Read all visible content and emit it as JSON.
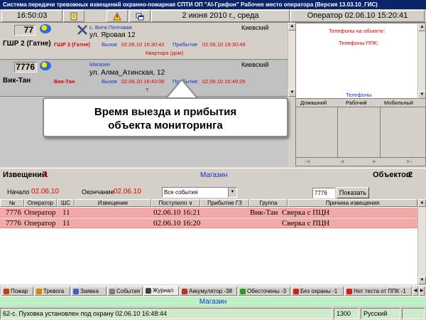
{
  "window": {
    "title": "Система передачи тревожных извещений охранно-пожарная СПТИ ОП \"AI-Грифон\" Рабочее место оператора (Версия 13.03.10_ГИС)"
  },
  "topbar": {
    "time": "16:50:03",
    "date": "2 июня 2010 г., среда",
    "operator": "Оператор  02.06.10 15:20:41"
  },
  "cards": [
    {
      "number": "77",
      "name": "ГШР 2 (Гатне)",
      "group": "ГШР 2 (Гатне)",
      "title": "с. Вита Почтовая",
      "address": "ул. Яровая 12",
      "district": "Киевский",
      "depart_label": "Вызов",
      "depart_time": "02.06.10 16:30:42",
      "arrive_label": "Прибытие",
      "arrive_time": "02.06.10 16:30:49",
      "extra": "Квартира (дом)"
    },
    {
      "number": "7776",
      "name": "Вик-Тан",
      "group": "Вик-Тан",
      "title": "Магазин",
      "address": "ул. Алма_Атинская, 12",
      "district": "Киевский",
      "depart_label": "Вызов",
      "depart_time": "02.06.10 16:43:06",
      "arrive_label": "Прибытие",
      "arrive_time": "02.06.10 16:49:29",
      "extra": "Т"
    }
  ],
  "right_panel": {
    "phones_object": "Телефоны на объекте:",
    "phones_ppk": "Телефоны ППК:",
    "phones_header": "Телефоны",
    "col_home": "Домашний",
    "col_work": "Рабочий",
    "col_mobile": "Мобильный"
  },
  "callout": {
    "line1": "Время выезда и прибытия",
    "line2": "объекта мониторинга"
  },
  "status_strip": {
    "notices_label": "Извещений",
    "notices_count": "1",
    "object_name": "Магазин",
    "objects_label": "Объектов",
    "objects_count": "2"
  },
  "filter": {
    "start_label": "Начало",
    "start_value": "02.06.10",
    "end_label": "Окончание",
    "end_value": "02.06.10",
    "events_select": "Все события",
    "object_input": "7776",
    "show_button": "Показать"
  },
  "table": {
    "headers": [
      "№",
      "Оператор",
      "ШС",
      "Извещение",
      "Поступило ∨",
      "Прибытие ГЗ",
      "Группа",
      "Причина извещения"
    ],
    "rows": [
      {
        "num": "7776",
        "operator": "Оператор",
        "zone": "11",
        "notice": "",
        "received": "02.06.10 16:21",
        "arrival": "",
        "group": "Вик-Тан",
        "reason": "Сверка с ПЦН"
      },
      {
        "num": "7776",
        "operator": "Оператор",
        "zone": "11",
        "notice": "",
        "received": "02.06.10 16:20",
        "arrival": "",
        "group": "",
        "reason": "Сверка с ПЦН"
      }
    ]
  },
  "tabs": [
    {
      "label": "Пожар",
      "color": "#c04010"
    },
    {
      "label": "Тревога",
      "color": "#e08000"
    },
    {
      "label": "Заявка",
      "color": "#4060c0"
    },
    {
      "label": "События",
      "color": "#808080"
    },
    {
      "label": "Журнал",
      "color": "#404040"
    },
    {
      "label": "Аккумулятор -38",
      "color": "#c03030"
    },
    {
      "label": "Обесточены -3",
      "color": "#20a020"
    },
    {
      "label": "Без охраны -1",
      "color": "#d02020"
    },
    {
      "label": "Нет теста от ППК -1",
      "color": "#d02020"
    }
  ],
  "banner": {
    "text": "Магазин"
  },
  "statusbar": {
    "message": "62-с. Пуховка установлен под охрану 02.06.10 16:48:44",
    "code": "1300",
    "lang": "Русский"
  }
}
